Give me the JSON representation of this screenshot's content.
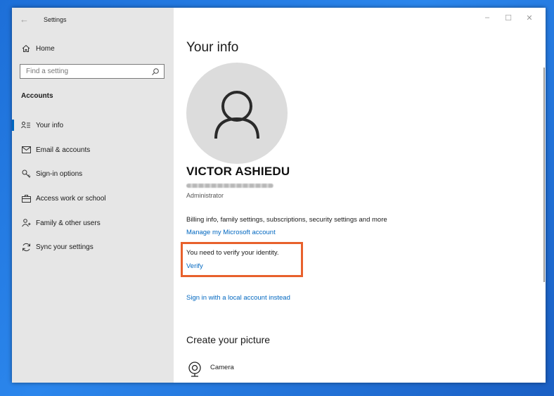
{
  "window": {
    "title": "Settings",
    "controls": [
      "–",
      "☐",
      "✕"
    ]
  },
  "sidebar": {
    "home_label": "Home",
    "search_placeholder": "Find a setting",
    "section_title": "Accounts",
    "items": [
      {
        "label": "Your info",
        "icon": "person-list-icon"
      },
      {
        "label": "Email & accounts",
        "icon": "mail-icon"
      },
      {
        "label": "Sign-in options",
        "icon": "key-icon"
      },
      {
        "label": "Access work or school",
        "icon": "briefcase-icon"
      },
      {
        "label": "Family & other users",
        "icon": "people-icon"
      },
      {
        "label": "Sync your settings",
        "icon": "sync-icon"
      }
    ]
  },
  "main": {
    "title": "Your info",
    "user_name": "VICTOR ASHIEDU",
    "role": "Administrator",
    "billing_text": "Billing info, family settings, subscriptions, security settings and more",
    "manage_link": "Manage my Microsoft account",
    "verify_message": "You need to verify your identity.",
    "verify_link": "Verify",
    "local_account_link": "Sign in with a local account instead",
    "create_picture_title": "Create your picture",
    "camera_label": "Camera"
  },
  "colors": {
    "accent": "#0067c0",
    "highlight_box": "#e8612c",
    "sidebar_bg": "#e6e6e6"
  }
}
